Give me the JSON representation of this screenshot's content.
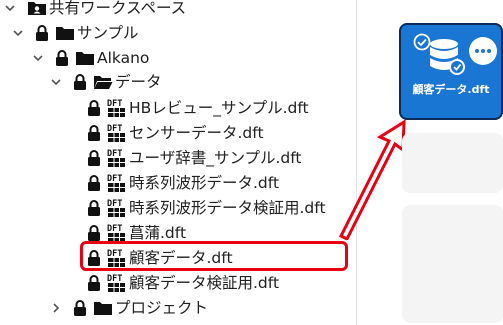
{
  "colors": {
    "accent_blue": "#1976d2",
    "highlight_red": "#e60012",
    "icon_dark": "#111111"
  },
  "tree": {
    "workspace": {
      "label": "共有ワークスペース",
      "icon": "shared-workspace-icon"
    },
    "sample": {
      "label": "サンプル",
      "icon": "folder-icon"
    },
    "alkano": {
      "label": "Alkano",
      "icon": "folder-icon"
    },
    "data": {
      "label": "データ",
      "icon": "folder-open-icon"
    },
    "files": [
      {
        "label": "HBレビュー_サンプル.dft"
      },
      {
        "label": "センサーデータ.dft"
      },
      {
        "label": "ユーザ辞書_サンプル.dft"
      },
      {
        "label": "時系列波形データ.dft"
      },
      {
        "label": "時系列波形データ検証用.dft"
      },
      {
        "label": "菖蒲.dft"
      },
      {
        "label": "顧客データ.dft"
      },
      {
        "label": "顧客データ検証用.dft"
      }
    ],
    "project": {
      "label": "プロジェクト",
      "icon": "folder-icon"
    }
  },
  "card": {
    "title": "顧客データ.dft",
    "icon": "database-icon"
  }
}
